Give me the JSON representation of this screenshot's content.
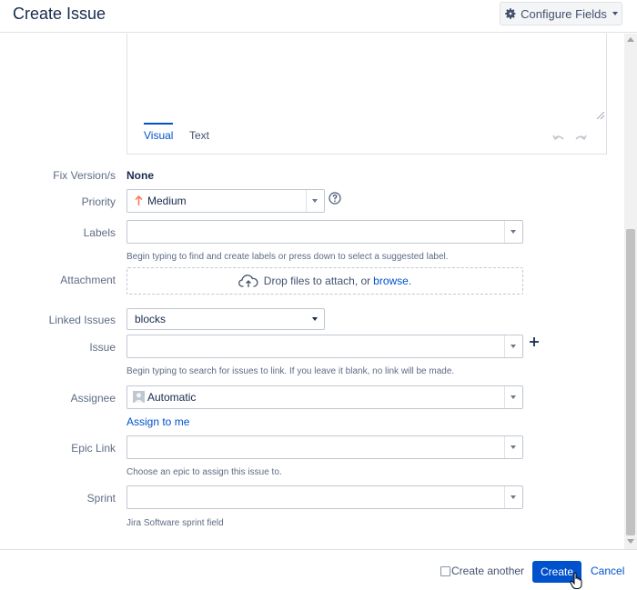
{
  "header": {
    "title": "Create Issue",
    "configure_label": "Configure Fields",
    "configure_icon": "gear-icon"
  },
  "editor": {
    "tabs": [
      {
        "label": "Visual",
        "active": true
      },
      {
        "label": "Text",
        "active": false
      }
    ],
    "undo_icon": "undo-icon",
    "redo_icon": "redo-icon"
  },
  "fields": {
    "fix_version": {
      "label": "Fix Version/s",
      "value": "None"
    },
    "priority": {
      "label": "Priority",
      "value": "Medium",
      "color": "#ff7452"
    },
    "labels": {
      "label": "Labels",
      "value": "",
      "help": "Begin typing to find and create labels or press down to select a suggested label."
    },
    "attachment": {
      "label": "Attachment",
      "drop_text": "Drop files to attach, or",
      "browse_text": "browse."
    },
    "linked_issues": {
      "label": "Linked Issues",
      "value": "blocks"
    },
    "issue": {
      "label": "Issue",
      "value": "",
      "help": "Begin typing to search for issues to link. If you leave it blank, no link will be made."
    },
    "assignee": {
      "label": "Assignee",
      "value": "Automatic",
      "assign_to_me": "Assign to me"
    },
    "epic_link": {
      "label": "Epic Link",
      "value": "",
      "help": "Choose an epic to assign this issue to."
    },
    "sprint": {
      "label": "Sprint",
      "value": "",
      "help": "Jira Software sprint field"
    }
  },
  "footer": {
    "create_another_label": "Create another",
    "create_label": "Create",
    "cancel_label": "Cancel"
  },
  "colors": {
    "accent": "#0052cc",
    "text": "#172b4d"
  }
}
